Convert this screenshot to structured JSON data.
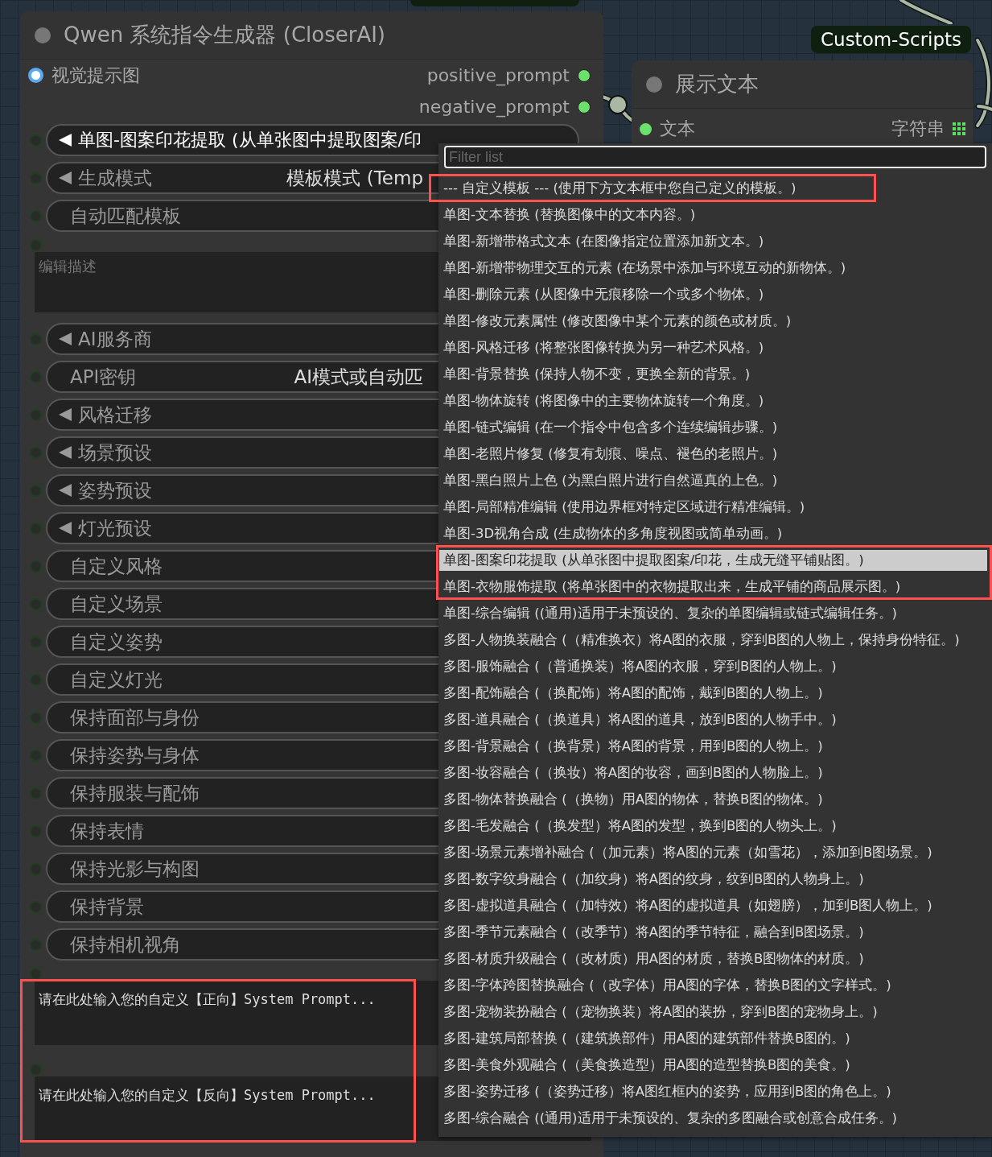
{
  "canvas_badge": {
    "label": "Custom-Scripts"
  },
  "main_node": {
    "title": "Qwen 系统指令生成器 (CloserAI)",
    "inputs": [
      {
        "label": "视觉提示图"
      }
    ],
    "outputs": [
      {
        "label": "positive_prompt"
      },
      {
        "label": "negative_prompt"
      }
    ],
    "widgets": [
      {
        "kind": "combo",
        "label": "单图-图案印花提取 (从单张图中提取图案/印",
        "open": true
      },
      {
        "kind": "combo",
        "label": "生成模式",
        "value": "模板模式 (Temp",
        "open": false
      },
      {
        "kind": "field",
        "label": "自动匹配模板",
        "open": false
      },
      {
        "kind": "textarea",
        "placeholder": "编辑描述"
      },
      {
        "kind": "combo",
        "label": "AI服务商",
        "open": false
      },
      {
        "kind": "field",
        "label": "API密钥",
        "value": "AI模式或自动匹",
        "open": false
      },
      {
        "kind": "combo",
        "label": "风格迁移",
        "open": false
      },
      {
        "kind": "combo",
        "label": "场景预设",
        "open": false
      },
      {
        "kind": "combo",
        "label": "姿势预设",
        "open": false
      },
      {
        "kind": "combo",
        "label": "灯光预设",
        "open": false
      },
      {
        "kind": "field",
        "label": "自定义风格",
        "open": false
      },
      {
        "kind": "field",
        "label": "自定义场景",
        "open": false
      },
      {
        "kind": "field",
        "label": "自定义姿势",
        "open": false
      },
      {
        "kind": "field",
        "label": "自定义灯光",
        "open": false
      },
      {
        "kind": "field",
        "label": "保持面部与身份",
        "open": false
      },
      {
        "kind": "field",
        "label": "保持姿势与身体",
        "open": false
      },
      {
        "kind": "field",
        "label": "保持服装与配饰",
        "open": false
      },
      {
        "kind": "field",
        "label": "保持表情",
        "open": false
      },
      {
        "kind": "field",
        "label": "保持光影与构图",
        "open": false
      },
      {
        "kind": "field",
        "label": "保持背景",
        "open": false
      },
      {
        "kind": "field",
        "label": "保持相机视角",
        "open": false
      },
      {
        "kind": "code",
        "placeholder": "请在此处输入您的自定义【正向】System Prompt..."
      },
      {
        "kind": "code",
        "placeholder": "请在此处输入您的自定义【反向】System Prompt..."
      }
    ]
  },
  "display_node": {
    "title": "展示文本",
    "outputs": [
      {
        "label": "文本",
        "type": "字符串"
      }
    ]
  },
  "dropdown": {
    "placeholder": "Filter list",
    "items": [
      {
        "label": "--- 自定义模板 --- (使用下方文本框中您自己定义的模板。)",
        "selected": false
      },
      {
        "label": "单图-文本替换 (替换图像中的文本内容。)",
        "selected": false
      },
      {
        "label": "单图-新增带格式文本 (在图像指定位置添加新文本。)",
        "selected": false
      },
      {
        "label": "单图-新增带物理交互的元素 (在场景中添加与环境互动的新物体。)",
        "selected": false
      },
      {
        "label": "单图-删除元素 (从图像中无痕移除一个或多个物体。)",
        "selected": false
      },
      {
        "label": "单图-修改元素属性 (修改图像中某个元素的颜色或材质。)",
        "selected": false
      },
      {
        "label": "单图-风格迁移 (将整张图像转换为另一种艺术风格。)",
        "selected": false
      },
      {
        "label": "单图-背景替换 (保持人物不变，更换全新的背景。)",
        "selected": false
      },
      {
        "label": "单图-物体旋转 (将图像中的主要物体旋转一个角度。)",
        "selected": false
      },
      {
        "label": "单图-链式编辑 (在一个指令中包含多个连续编辑步骤。)",
        "selected": false
      },
      {
        "label": "单图-老照片修复 (修复有划痕、噪点、褪色的老照片。)",
        "selected": false
      },
      {
        "label": "单图-黑白照片上色 (为黑白照片进行自然逼真的上色。)",
        "selected": false
      },
      {
        "label": "单图-局部精准编辑 (使用边界框对特定区域进行精准编辑。)",
        "selected": false
      },
      {
        "label": "单图-3D视角合成 (生成物体的多角度视图或简单动画。)",
        "selected": false
      },
      {
        "label": "单图-图案印花提取 (从单张图中提取图案/印花，生成无缝平铺贴图。)",
        "selected": true
      },
      {
        "label": "单图-衣物服饰提取 (将单张图中的衣物提取出来，生成平铺的商品展示图。)",
        "selected": false
      },
      {
        "label": "单图-综合编辑 ((通用)适用于未预设的、复杂的单图编辑或链式编辑任务。)",
        "selected": false
      },
      {
        "label": "多图-人物换装融合 (（精准换衣）将A图的衣服，穿到B图的人物上，保持身份特征。)",
        "selected": false
      },
      {
        "label": "多图-服饰融合 (（普通换装）将A图的衣服，穿到B图的人物上。)",
        "selected": false
      },
      {
        "label": "多图-配饰融合 (（换配饰）将A图的配饰，戴到B图的人物上。)",
        "selected": false
      },
      {
        "label": "多图-道具融合 (（换道具）将A图的道具，放到B图的人物手中。)",
        "selected": false
      },
      {
        "label": "多图-背景融合 (（换背景）将A图的背景，用到B图的人物上。)",
        "selected": false
      },
      {
        "label": "多图-妆容融合 (（换妆）将A图的妆容，画到B图的人物脸上。)",
        "selected": false
      },
      {
        "label": "多图-物体替换融合 (（换物）用A图的物体，替换B图的物体。)",
        "selected": false
      },
      {
        "label": "多图-毛发融合 (（换发型）将A图的发型，换到B图的人物头上。)",
        "selected": false
      },
      {
        "label": "多图-场景元素增补融合 (（加元素）将A图的元素（如雪花），添加到B图场景。)",
        "selected": false
      },
      {
        "label": "多图-数字纹身融合 (（加纹身）将A图的纹身，纹到B图的人物身上。)",
        "selected": false
      },
      {
        "label": "多图-虚拟道具融合 (（加特效）将A图的虚拟道具（如翅膀），加到B图人物上。)",
        "selected": false
      },
      {
        "label": "多图-季节元素融合 (（改季节）将A图的季节特征，融合到B图场景。)",
        "selected": false
      },
      {
        "label": "多图-材质升级融合 (（改材质）用A图的材质，替换B图物体的材质。)",
        "selected": false
      },
      {
        "label": "多图-字体跨图替换融合 (（改字体）用A图的字体，替换B图的文字样式。)",
        "selected": false
      },
      {
        "label": "多图-宠物装扮融合 (（宠物换装）将A图的装扮，穿到B图的宠物身上。)",
        "selected": false
      },
      {
        "label": "多图-建筑局部替换 (（建筑换部件）用A图的建筑部件替换B图的。)",
        "selected": false
      },
      {
        "label": "多图-美食外观融合 (（美食换造型）用A图的造型替换B图的美食。)",
        "selected": false
      },
      {
        "label": "多图-姿势迁移 (（姿势迁移）将A图红框内的姿势，应用到B图的角色上。)",
        "selected": false
      },
      {
        "label": "多图-综合融合 ((通用)适用于未预设的、复杂的多图融合或创意合成任务。)",
        "selected": false
      }
    ]
  }
}
